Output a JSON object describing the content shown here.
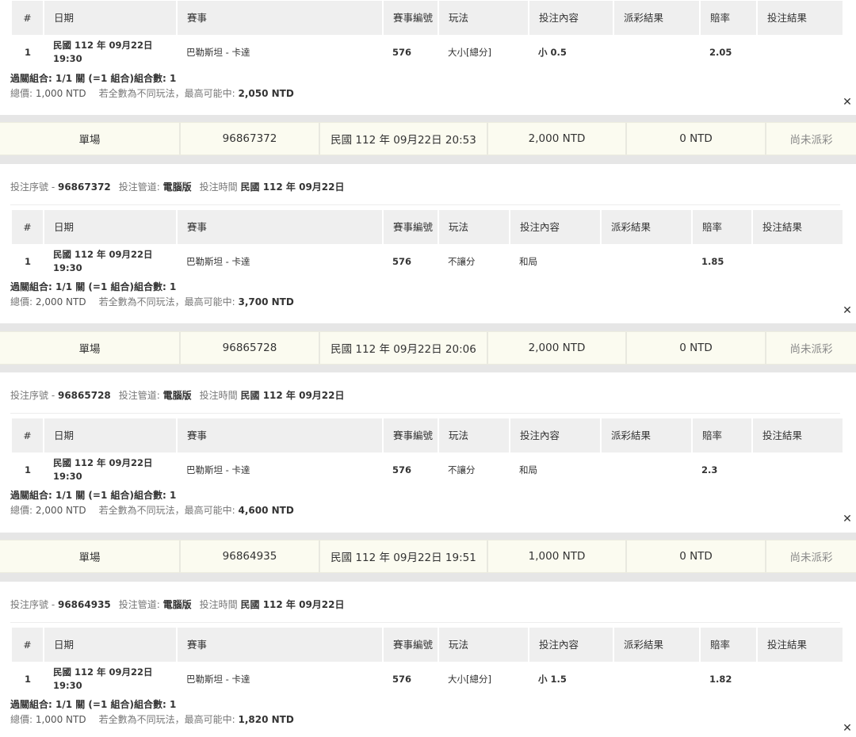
{
  "headers": [
    "#",
    "日期",
    "賽事",
    "賽事編號",
    "玩法",
    "投注內容",
    "派彩結果",
    "賠率",
    "投注結果"
  ],
  "labels": {
    "order_no": "投注序號 -",
    "channel": "投注管道:",
    "bet_time": "投注時間",
    "total": "總價:",
    "max_win": "若全數為不同玩法，最高可能中:"
  },
  "blocks": [
    {
      "summary": null,
      "order": null,
      "row": {
        "index": "1",
        "date": "民國 112 年 09月22日",
        "time": "19:30",
        "match": "巴勒斯坦 - 卡達",
        "match_no": "576",
        "play": "大小[總分]",
        "content": "小 0.5",
        "payout": "",
        "odds": "2.05",
        "result": ""
      },
      "combo": "過關組合: 1/1 關 (=1 組合)組合數: 1",
      "total": "1,000 NTD",
      "max_win": "2,050 NTD"
    },
    {
      "summary": {
        "type": "單場",
        "ticket": "96867372",
        "time": "民國 112 年 09月22日 20:53",
        "stake": "2,000 NTD",
        "payout": "0 NTD",
        "status": "尚未派彩"
      },
      "order": {
        "no": "96867372",
        "channel": "電腦版",
        "time": "民國 112 年 09月22日"
      },
      "row": {
        "index": "1",
        "date": "民國 112 年 09月22日",
        "time": "19:30",
        "match": "巴勒斯坦 - 卡達",
        "match_no": "576",
        "play": "不讓分",
        "content": "和局",
        "payout": "",
        "odds": "1.85",
        "result": ""
      },
      "combo": "過關組合: 1/1 關 (=1 組合)組合數: 1",
      "total": "2,000 NTD",
      "max_win": "3,700 NTD"
    },
    {
      "summary": {
        "type": "單場",
        "ticket": "96865728",
        "time": "民國 112 年 09月22日 20:06",
        "stake": "2,000 NTD",
        "payout": "0 NTD",
        "status": "尚未派彩"
      },
      "order": {
        "no": "96865728",
        "channel": "電腦版",
        "time": "民國 112 年 09月22日"
      },
      "row": {
        "index": "1",
        "date": "民國 112 年 09月22日",
        "time": "19:30",
        "match": "巴勒斯坦 - 卡達",
        "match_no": "576",
        "play": "不讓分",
        "content": "和局",
        "payout": "",
        "odds": "2.3",
        "result": ""
      },
      "combo": "過關組合: 1/1 關 (=1 組合)組合數: 1",
      "total": "2,000 NTD",
      "max_win": "4,600 NTD"
    },
    {
      "summary": {
        "type": "單場",
        "ticket": "96864935",
        "time": "民國 112 年 09月22日 19:51",
        "stake": "1,000 NTD",
        "payout": "0 NTD",
        "status": "尚未派彩"
      },
      "order": {
        "no": "96864935",
        "channel": "電腦版",
        "time": "民國 112 年 09月22日"
      },
      "row": {
        "index": "1",
        "date": "民國 112 年 09月22日",
        "time": "19:30",
        "match": "巴勒斯坦 - 卡達",
        "match_no": "576",
        "play": "大小[總分]",
        "content": "小 1.5",
        "payout": "",
        "odds": "1.82",
        "result": ""
      },
      "combo": "過關組合: 1/1 關 (=1 組合)組合數: 1",
      "total": "1,000 NTD",
      "max_win": "1,820 NTD"
    }
  ]
}
